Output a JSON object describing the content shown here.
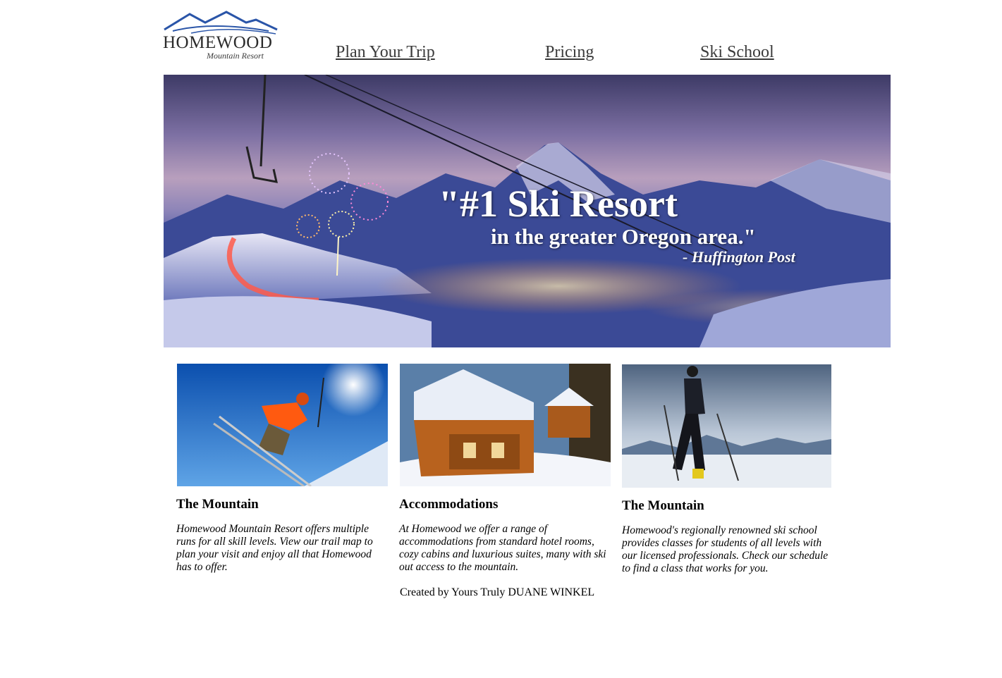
{
  "header": {
    "logo": {
      "name": "HOMEWOOD",
      "tagline": "Mountain Resort"
    },
    "nav": [
      {
        "label": "Plan Your Trip"
      },
      {
        "label": "Pricing"
      },
      {
        "label": "Ski School"
      }
    ]
  },
  "hero": {
    "quote": "\"#1 Ski Resort",
    "subquote": "in the greater Oregon area.\"",
    "source": "- Huffington Post"
  },
  "features": [
    {
      "title": "The Mountain",
      "text": "Homewood Mountain Resort offers multiple runs for all skill levels. View our trail map to plan your visit and enjoy all that Homewood has to offer."
    },
    {
      "title": "Accommodations",
      "text": "At Homewood we offer a range of accommodations from standard hotel rooms, cozy cabins and luxurious suites, many with ski out access to the mountain."
    },
    {
      "title": "The Mountain",
      "text": "Homewood's regionally renowned ski school provides classes for students of all levels with our licensed professionals. Check our schedule to find a class that works for you."
    }
  ],
  "footer": {
    "credit": "Created by Yours Truly DUANE WINKEL"
  },
  "colors": {
    "logo_blue": "#2a55a8",
    "link_text": "#3b3b3b"
  }
}
